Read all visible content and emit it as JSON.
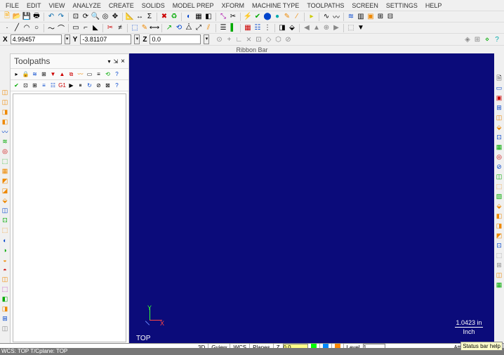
{
  "menu": [
    "FILE",
    "EDIT",
    "VIEW",
    "ANALYZE",
    "CREATE",
    "SOLIDS",
    "MODEL PREP",
    "XFORM",
    "MACHINE TYPE",
    "TOOLPATHS",
    "SCREEN",
    "SETTINGS",
    "HELP"
  ],
  "coords": {
    "x_label": "X",
    "x_value": "4.99457",
    "y_label": "Y",
    "y_value": "-3.81107",
    "z_label": "Z",
    "z_value": "0.0"
  },
  "ribbon_label": "Ribbon Bar",
  "side_panel": {
    "title": "Toolpaths",
    "pin_icon": "📌",
    "close_icon": "×"
  },
  "viewport": {
    "view_label": "TOP",
    "axis_x": "X",
    "axis_y": "Y",
    "scale_value": "1.0423 in",
    "scale_unit": "Inch"
  },
  "status": {
    "btn_3d": "3D",
    "btn_gview": "Gview",
    "btn_wcs": "WCS",
    "btn_planes": "Planes",
    "z_label": "Z",
    "z_value": "0.0",
    "level_label": "Level",
    "level_value": "1",
    "attributes_label": "Attributes"
  },
  "wcs_text": "WCS: TOP  T/Cplane: TOP",
  "tooltip": "Status bar help",
  "toolbar1_icons": [
    {
      "name": "new-file-icon",
      "glyph": "🗎",
      "cls": "c-new"
    },
    {
      "name": "open-file-icon",
      "glyph": "📂",
      "cls": "c-open"
    },
    {
      "name": "save-icon",
      "glyph": "💾",
      "cls": "c-save"
    },
    {
      "name": "print-icon",
      "glyph": "🖶",
      "cls": ""
    },
    {
      "name": "sep"
    },
    {
      "name": "undo-icon",
      "glyph": "↶",
      "cls": "c-undo"
    },
    {
      "name": "redo-icon",
      "glyph": "↷",
      "cls": "c-undo"
    },
    {
      "name": "sep"
    },
    {
      "name": "fit-icon",
      "glyph": "⊡",
      "cls": ""
    },
    {
      "name": "repaint-icon",
      "glyph": "⟳",
      "cls": ""
    },
    {
      "name": "zoom-window-icon",
      "glyph": "🔍",
      "cls": ""
    },
    {
      "name": "zoom-target-icon",
      "glyph": "◎",
      "cls": ""
    },
    {
      "name": "pan-icon",
      "glyph": "✥",
      "cls": ""
    },
    {
      "name": "sep"
    },
    {
      "name": "analyze-icon",
      "glyph": "📐",
      "cls": "c-blue"
    },
    {
      "name": "dist-icon",
      "glyph": "↔",
      "cls": ""
    },
    {
      "name": "statistics-icon",
      "glyph": "Σ",
      "cls": ""
    },
    {
      "name": "sep"
    },
    {
      "name": "delete-icon",
      "glyph": "✖",
      "cls": "c-red"
    },
    {
      "name": "undelete-icon",
      "glyph": "♻",
      "cls": "c-green"
    },
    {
      "name": "sep"
    },
    {
      "name": "shade-icon",
      "glyph": "◐",
      "cls": "c-blue"
    },
    {
      "name": "wireframe-icon",
      "glyph": "▦",
      "cls": ""
    },
    {
      "name": "hidden-icon",
      "glyph": "◧",
      "cls": ""
    },
    {
      "name": "sep"
    },
    {
      "name": "xform-icon",
      "glyph": "⤡",
      "cls": "c-purple"
    },
    {
      "name": "trim-icon",
      "glyph": "✂",
      "cls": ""
    },
    {
      "name": "sep"
    },
    {
      "name": "bolt-icon",
      "glyph": "⚡",
      "cls": "c-yellow"
    },
    {
      "name": "check-icon",
      "glyph": "✔",
      "cls": "c-green"
    },
    {
      "name": "sphere-icon",
      "glyph": "⬤",
      "cls": "c-blue"
    },
    {
      "name": "disc-icon",
      "glyph": "●",
      "cls": "c-cyan"
    },
    {
      "name": "pencil-icon",
      "glyph": "✎",
      "cls": "c-orange"
    },
    {
      "name": "slash-icon",
      "glyph": "⁄",
      "cls": "c-orange"
    },
    {
      "name": "sep"
    },
    {
      "name": "arrow-icon",
      "glyph": "▸",
      "cls": "c-yellow"
    },
    {
      "name": "sep"
    },
    {
      "name": "curve1-icon",
      "glyph": "∿",
      "cls": ""
    },
    {
      "name": "curve2-icon",
      "glyph": "〰",
      "cls": ""
    },
    {
      "name": "sep"
    },
    {
      "name": "wave-icon",
      "glyph": "≋",
      "cls": "c-blue"
    },
    {
      "name": "grid2-icon",
      "glyph": "▥",
      "cls": ""
    },
    {
      "name": "box3-icon",
      "glyph": "▣",
      "cls": "c-orange"
    },
    {
      "name": "grid3-icon",
      "glyph": "⊞",
      "cls": ""
    },
    {
      "name": "grid4-icon",
      "glyph": "⊟",
      "cls": ""
    }
  ],
  "toolbar2_icons": [
    {
      "name": "point-icon",
      "glyph": "·",
      "cls": ""
    },
    {
      "name": "line-icon",
      "glyph": "╱",
      "cls": ""
    },
    {
      "name": "arc-icon",
      "glyph": "◠",
      "cls": ""
    },
    {
      "name": "circle-icon",
      "glyph": "○",
      "cls": ""
    },
    {
      "name": "sep"
    },
    {
      "name": "spline-icon",
      "glyph": "〜",
      "cls": ""
    },
    {
      "name": "curve-icon",
      "glyph": "⌒",
      "cls": ""
    },
    {
      "name": "sep"
    },
    {
      "name": "rect-icon",
      "glyph": "▭",
      "cls": ""
    },
    {
      "name": "fillet-icon",
      "glyph": "⌐",
      "cls": ""
    },
    {
      "name": "chamfer-icon",
      "glyph": "◣",
      "cls": ""
    },
    {
      "name": "sep"
    },
    {
      "name": "scissors-icon",
      "glyph": "✂",
      "cls": "c-red"
    },
    {
      "name": "break-icon",
      "glyph": "≠",
      "cls": ""
    },
    {
      "name": "sep"
    },
    {
      "name": "draft-icon",
      "glyph": "⬚",
      "cls": "c-blue"
    },
    {
      "name": "note-icon",
      "glyph": "✎",
      "cls": "c-orange"
    },
    {
      "name": "dim-icon",
      "glyph": "⟷",
      "cls": ""
    },
    {
      "name": "sep"
    },
    {
      "name": "translate-icon",
      "glyph": "↗",
      "cls": "c-green"
    },
    {
      "name": "rotate-icon",
      "glyph": "⟲",
      "cls": "c-blue"
    },
    {
      "name": "mirror-icon",
      "glyph": "⧊",
      "cls": ""
    },
    {
      "name": "scale-icon",
      "glyph": "⤢",
      "cls": ""
    },
    {
      "name": "offset-icon",
      "glyph": "⫽",
      "cls": "c-orange"
    },
    {
      "name": "sep"
    },
    {
      "name": "level-icon",
      "glyph": "☰",
      "cls": ""
    },
    {
      "name": "color-icon",
      "glyph": "▌",
      "cls": "c-green"
    },
    {
      "name": "sep"
    },
    {
      "name": "grid5-icon",
      "glyph": "▦",
      "cls": "c-red"
    },
    {
      "name": "list-icon",
      "glyph": "☷",
      "cls": "c-blue"
    },
    {
      "name": "dots-icon",
      "glyph": "⋮",
      "cls": ""
    },
    {
      "name": "sep"
    },
    {
      "name": "t1-icon",
      "glyph": "◨",
      "cls": ""
    },
    {
      "name": "t2-icon",
      "glyph": "⬙",
      "cls": ""
    },
    {
      "name": "sep"
    },
    {
      "name": "back-icon",
      "glyph": "◀",
      "cls": "c-gray"
    },
    {
      "name": "up-icon",
      "glyph": "▲",
      "cls": "c-gray"
    },
    {
      "name": "globe-icon",
      "glyph": "⊕",
      "cls": "c-gray"
    },
    {
      "name": "fwd-icon",
      "glyph": "▶",
      "cls": "c-gray"
    },
    {
      "name": "sep"
    },
    {
      "name": "cube-icon",
      "glyph": "⬚",
      "cls": "c-gray"
    },
    {
      "name": "down2-icon",
      "glyph": "▼",
      "cls": ""
    }
  ],
  "toolbar3_icons": [
    {
      "name": "c1-icon",
      "glyph": "⊙",
      "cls": "c-gray"
    },
    {
      "name": "c2-icon",
      "glyph": "+",
      "cls": "c-gray"
    },
    {
      "name": "c3-icon",
      "glyph": "∟",
      "cls": "c-gray"
    },
    {
      "name": "c4-icon",
      "glyph": "⨯",
      "cls": "c-gray"
    },
    {
      "name": "c5-icon",
      "glyph": "⊡",
      "cls": "c-gray"
    },
    {
      "name": "c6-icon",
      "glyph": "◇",
      "cls": "c-gray"
    },
    {
      "name": "c7-icon",
      "glyph": "⬡",
      "cls": "c-gray"
    },
    {
      "name": "c8-icon",
      "glyph": "⊘",
      "cls": "c-gray"
    },
    {
      "name": "c9-icon",
      "glyph": "◈",
      "cls": "c-gray"
    },
    {
      "name": "c10-icon",
      "glyph": "⊞",
      "cls": "c-gray"
    },
    {
      "name": "c11-icon",
      "glyph": "⋄",
      "cls": "c-green"
    },
    {
      "name": "help2-icon",
      "glyph": "?",
      "cls": "c-cyan"
    }
  ],
  "left_icons": [
    {
      "name": "lm1",
      "glyph": "◫",
      "cls": "c-orange"
    },
    {
      "name": "lm2",
      "glyph": "◫",
      "cls": "c-orange"
    },
    {
      "name": "lm3",
      "glyph": "◨",
      "cls": "c-orange"
    },
    {
      "name": "lm4",
      "glyph": "◧",
      "cls": "c-orange"
    },
    {
      "name": "lm5",
      "glyph": "〰",
      "cls": "c-blue"
    },
    {
      "name": "lm6",
      "glyph": "≋",
      "cls": "c-green"
    },
    {
      "name": "lm7",
      "glyph": "◎",
      "cls": "c-red"
    },
    {
      "name": "lm8",
      "glyph": "⬚",
      "cls": "c-green"
    },
    {
      "name": "lm9",
      "glyph": "▦",
      "cls": "c-orange"
    },
    {
      "name": "lm10",
      "glyph": "◩",
      "cls": "c-orange"
    },
    {
      "name": "lm11",
      "glyph": "◪",
      "cls": "c-orange"
    },
    {
      "name": "lm12",
      "glyph": "⬙",
      "cls": "c-orange"
    },
    {
      "name": "lm13",
      "glyph": "◫",
      "cls": "c-blue"
    },
    {
      "name": "lm14",
      "glyph": "⊡",
      "cls": "c-green"
    },
    {
      "name": "lm15",
      "glyph": "⬚",
      "cls": "c-orange"
    },
    {
      "name": "lm16",
      "glyph": "◐",
      "cls": "c-blue"
    },
    {
      "name": "lm17",
      "glyph": "◑",
      "cls": "c-green"
    },
    {
      "name": "lm18",
      "glyph": "◒",
      "cls": "c-orange"
    },
    {
      "name": "lm19",
      "glyph": "◓",
      "cls": "c-red"
    },
    {
      "name": "lm20",
      "glyph": "◫",
      "cls": "c-orange"
    },
    {
      "name": "lm21",
      "glyph": "⬚",
      "cls": "c-purple"
    },
    {
      "name": "lm22",
      "glyph": "◧",
      "cls": "c-green"
    },
    {
      "name": "lm23",
      "glyph": "◨",
      "cls": "c-orange"
    },
    {
      "name": "lm24",
      "glyph": "⊞",
      "cls": "c-blue"
    },
    {
      "name": "lm25",
      "glyph": "◫",
      "cls": "c-gray"
    }
  ],
  "right_icons": [
    {
      "name": "rm1",
      "glyph": "🗎",
      "cls": ""
    },
    {
      "name": "rm2",
      "glyph": "▭",
      "cls": "c-blue"
    },
    {
      "name": "rm3",
      "glyph": "▣",
      "cls": "c-red"
    },
    {
      "name": "rm4",
      "glyph": "⊞",
      "cls": "c-blue"
    },
    {
      "name": "rm5",
      "glyph": "◫",
      "cls": "c-orange"
    },
    {
      "name": "rm6",
      "glyph": "⬙",
      "cls": "c-orange"
    },
    {
      "name": "rm7",
      "glyph": "⊡",
      "cls": "c-blue"
    },
    {
      "name": "rm8",
      "glyph": "▦",
      "cls": "c-green"
    },
    {
      "name": "rm9",
      "glyph": "◎",
      "cls": "c-red"
    },
    {
      "name": "rm10",
      "glyph": "⊘",
      "cls": "c-blue"
    },
    {
      "name": "rm11",
      "glyph": "◫",
      "cls": "c-green"
    },
    {
      "name": "rm12",
      "glyph": "⬚",
      "cls": "c-orange"
    },
    {
      "name": "rm13",
      "glyph": "▧",
      "cls": "c-green"
    },
    {
      "name": "rm14",
      "glyph": "⬙",
      "cls": "c-orange"
    },
    {
      "name": "rm15",
      "glyph": "◧",
      "cls": "c-orange"
    },
    {
      "name": "rm16",
      "glyph": "◨",
      "cls": "c-orange"
    },
    {
      "name": "rm17",
      "glyph": "◩",
      "cls": "c-orange"
    },
    {
      "name": "rm18",
      "glyph": "⊡",
      "cls": "c-blue"
    },
    {
      "name": "rm19",
      "glyph": "⬚",
      "cls": "c-gray"
    },
    {
      "name": "rm20",
      "glyph": "⊞",
      "cls": "c-gray"
    },
    {
      "name": "rm21",
      "glyph": "◫",
      "cls": "c-orange"
    },
    {
      "name": "rm22",
      "glyph": "▦",
      "cls": "c-green"
    }
  ],
  "side_tb1": [
    {
      "name": "st1",
      "glyph": "▸",
      "cls": ""
    },
    {
      "name": "st2",
      "glyph": "🔒",
      "cls": ""
    },
    {
      "name": "st3",
      "glyph": "≋",
      "cls": "c-blue"
    },
    {
      "name": "st4",
      "glyph": "⊞",
      "cls": ""
    },
    {
      "name": "st5",
      "glyph": "▼",
      "cls": "c-red"
    },
    {
      "name": "st6",
      "glyph": "▲",
      "cls": "c-red"
    },
    {
      "name": "st7",
      "glyph": "⧉",
      "cls": "c-red"
    },
    {
      "name": "st8",
      "glyph": "〰",
      "cls": "c-orange"
    },
    {
      "name": "st9",
      "glyph": "▭",
      "cls": ""
    },
    {
      "name": "st10",
      "glyph": "≡",
      "cls": ""
    },
    {
      "name": "st11",
      "glyph": "⟲",
      "cls": "c-green"
    },
    {
      "name": "st12",
      "glyph": "?",
      "cls": "c-blue"
    }
  ],
  "side_tb2": [
    {
      "name": "sb1",
      "glyph": "✔",
      "cls": "c-green"
    },
    {
      "name": "sb2",
      "glyph": "⊡",
      "cls": ""
    },
    {
      "name": "sb3",
      "glyph": "⊞",
      "cls": ""
    },
    {
      "name": "sb4",
      "glyph": "≡",
      "cls": "c-blue"
    },
    {
      "name": "sb5",
      "glyph": "☷",
      "cls": "c-blue"
    },
    {
      "name": "sb6",
      "glyph": "G1",
      "cls": "c-red"
    },
    {
      "name": "sb7",
      "glyph": "▶",
      "cls": ""
    },
    {
      "name": "sb8",
      "glyph": "⏸",
      "cls": ""
    },
    {
      "name": "sb9",
      "glyph": "↻",
      "cls": "c-blue"
    },
    {
      "name": "sb10",
      "glyph": "⊘",
      "cls": ""
    },
    {
      "name": "sb11",
      "glyph": "⊠",
      "cls": ""
    },
    {
      "name": "sb12",
      "glyph": "?",
      "cls": "c-blue"
    }
  ]
}
